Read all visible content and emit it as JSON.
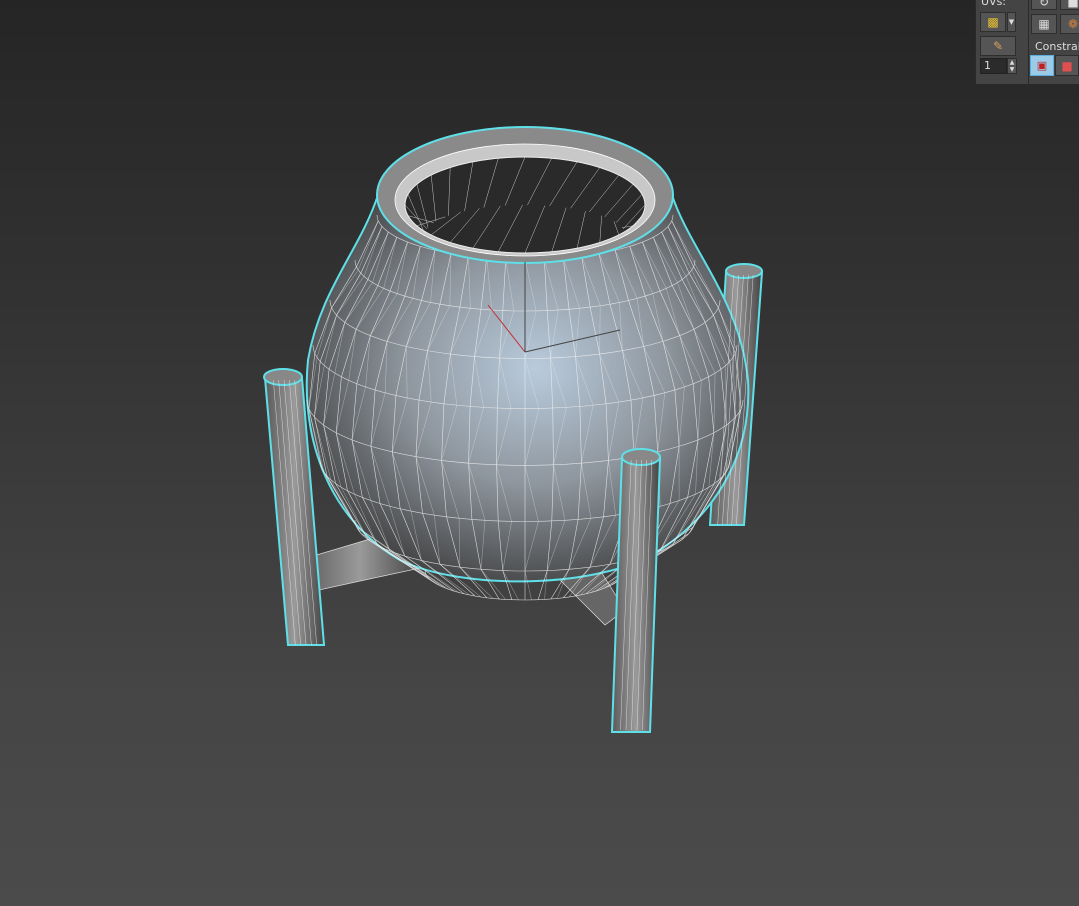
{
  "panel": {
    "uvs_label": "UVs:",
    "constraints_label": "Constrai",
    "spinner_value": "1",
    "buttons": [
      "lock-selection-icon",
      "dropdown-icon",
      "paint-selection-icon",
      "rotate-icon",
      "select-grid-icon",
      "brush-icon",
      "constraint-none-icon",
      "constraint-face-icon"
    ]
  },
  "viewport": {
    "selection_color": "#5fe0e8",
    "wire_color": "#f0f0f0",
    "axis_colors": {
      "x": "#c03030",
      "y": "#4a4a4a",
      "z": "#444"
    }
  }
}
